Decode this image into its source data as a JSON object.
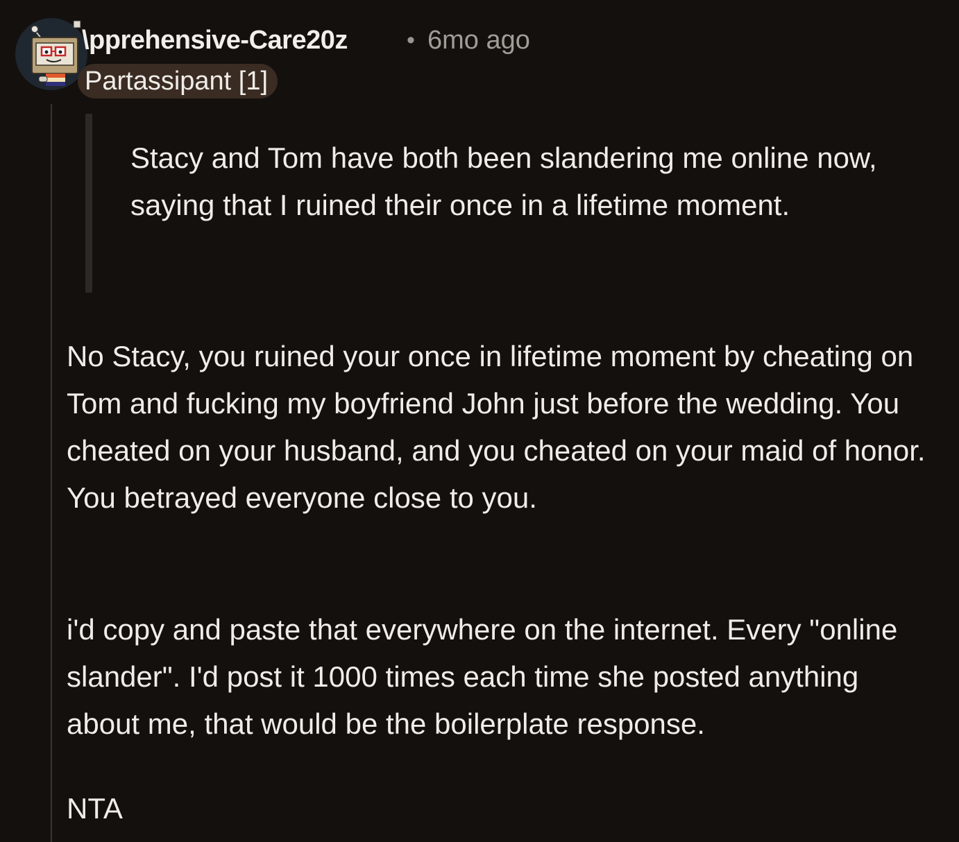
{
  "comment": {
    "username": "\\pprehensive-Care20z",
    "separator": "•",
    "timestamp": "6mo ago",
    "flair": "Partassipant [1]",
    "avatar_icon": "robot-avatar-icon",
    "quote": "Stacy and Tom have both been slandering me online now, saying that I ruined their once in a lifetime moment.",
    "paragraphs": [
      "No Stacy, you ruined your once in lifetime moment by cheating on Tom and fucking my boyfriend John just before the wedding. You cheated on your husband, and you cheated on your maid of honor. You betrayed everyone close to you.",
      "i'd copy and paste that everywhere on the internet. Every \"online slander\". I'd post it 1000 times each time she posted anything about me, that would be the boilerplate response.",
      "NTA"
    ]
  },
  "colors": {
    "background": "#13100e",
    "text": "#f0ede9",
    "muted": "#a29c96",
    "flair_bg": "#3a2c23",
    "thread_line": "#3a3532"
  }
}
